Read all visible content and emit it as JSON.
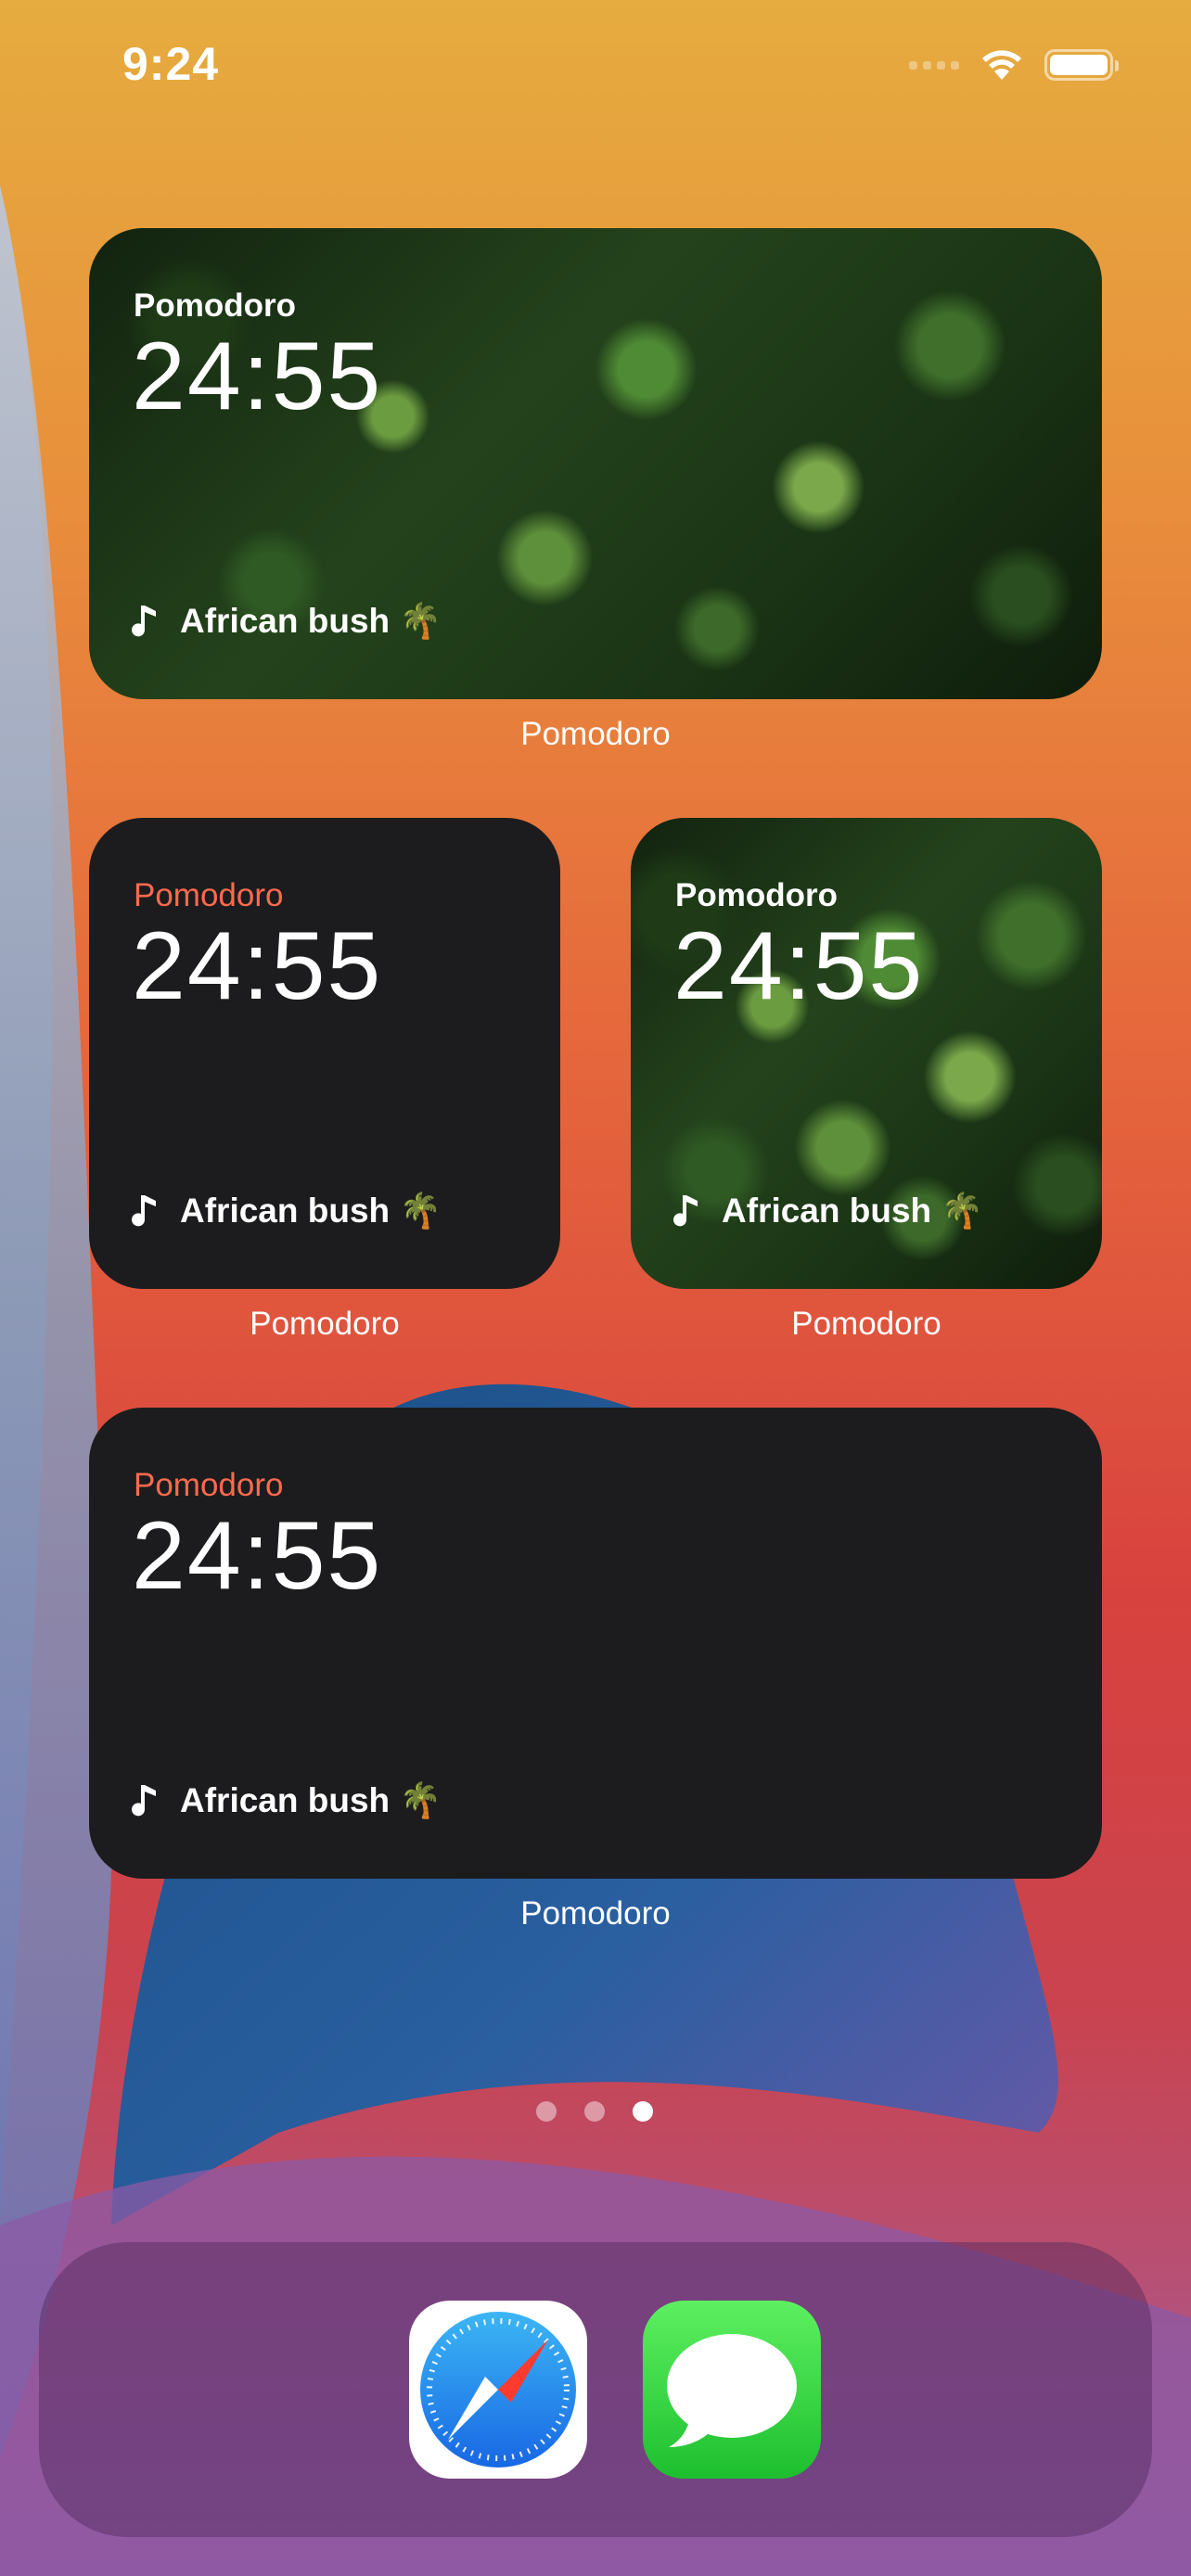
{
  "status_bar": {
    "time": "9:24"
  },
  "widgets": [
    {
      "title": "Pomodoro",
      "timer": "24:55",
      "sound": "African bush 🌴",
      "label": "Pomodoro",
      "style": "forest-image",
      "size": "medium"
    },
    {
      "title": "Pomodoro",
      "timer": "24:55",
      "sound": "African bush 🌴",
      "label": "Pomodoro",
      "style": "dark",
      "size": "small"
    },
    {
      "title": "Pomodoro",
      "timer": "24:55",
      "sound": "African bush 🌴",
      "label": "Pomodoro",
      "style": "forest-image",
      "size": "small"
    },
    {
      "title": "Pomodoro",
      "timer": "24:55",
      "sound": "African bush 🌴",
      "label": "Pomodoro",
      "style": "dark",
      "size": "medium"
    }
  ],
  "page_indicator": {
    "count": 3,
    "active_index": 2
  },
  "dock": {
    "apps": [
      {
        "name": "Safari",
        "icon": "safari-compass-icon"
      },
      {
        "name": "Messages",
        "icon": "messages-bubble-icon"
      }
    ]
  },
  "colors": {
    "accent_title": "#ff6a4d",
    "widget_dark": "#1c1c1e"
  }
}
